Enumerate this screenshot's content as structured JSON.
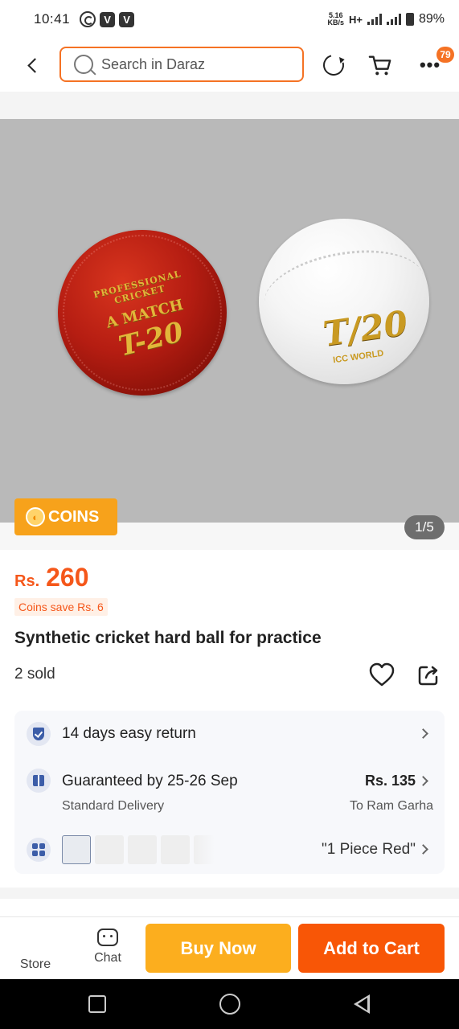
{
  "status_bar": {
    "time": "10:41",
    "speed_value": "5.16",
    "speed_unit": "KB/s",
    "network": "H+",
    "battery": "89%"
  },
  "search": {
    "placeholder": "Search in Daraz"
  },
  "nav": {
    "more_badge": "79"
  },
  "gallery": {
    "coins_label": "COINS",
    "page_indicator": "1/5",
    "red_ball_print_top": "PROFESSIONAL CRICKET",
    "red_ball_print_mid": "A MATCH",
    "red_ball_print_big": "T-20",
    "white_ball_print_big": "T/20",
    "white_ball_print_small": "ICC WORLD"
  },
  "product": {
    "currency": "Rs.",
    "price": "260",
    "coins_save": "Coins save Rs. 6",
    "title": "Synthetic cricket hard ball for practice",
    "sold": "2 sold"
  },
  "info": {
    "return_text": "14 days easy return",
    "delivery_guarantee": "Guaranteed by 25-26 Sep",
    "delivery_price": "Rs. 135",
    "delivery_type": "Standard Delivery",
    "delivery_location": "To Ram Garha",
    "variant": "\"1 Piece Red\""
  },
  "actions": {
    "store": "Store",
    "chat": "Chat",
    "buy_now": "Buy Now",
    "add_to_cart": "Add to Cart"
  },
  "colors": {
    "brand_orange": "#f85606",
    "buy_now_yellow": "#fcae1e",
    "price_orange": "#f5571a",
    "coins_tag": "#f7a21b"
  }
}
